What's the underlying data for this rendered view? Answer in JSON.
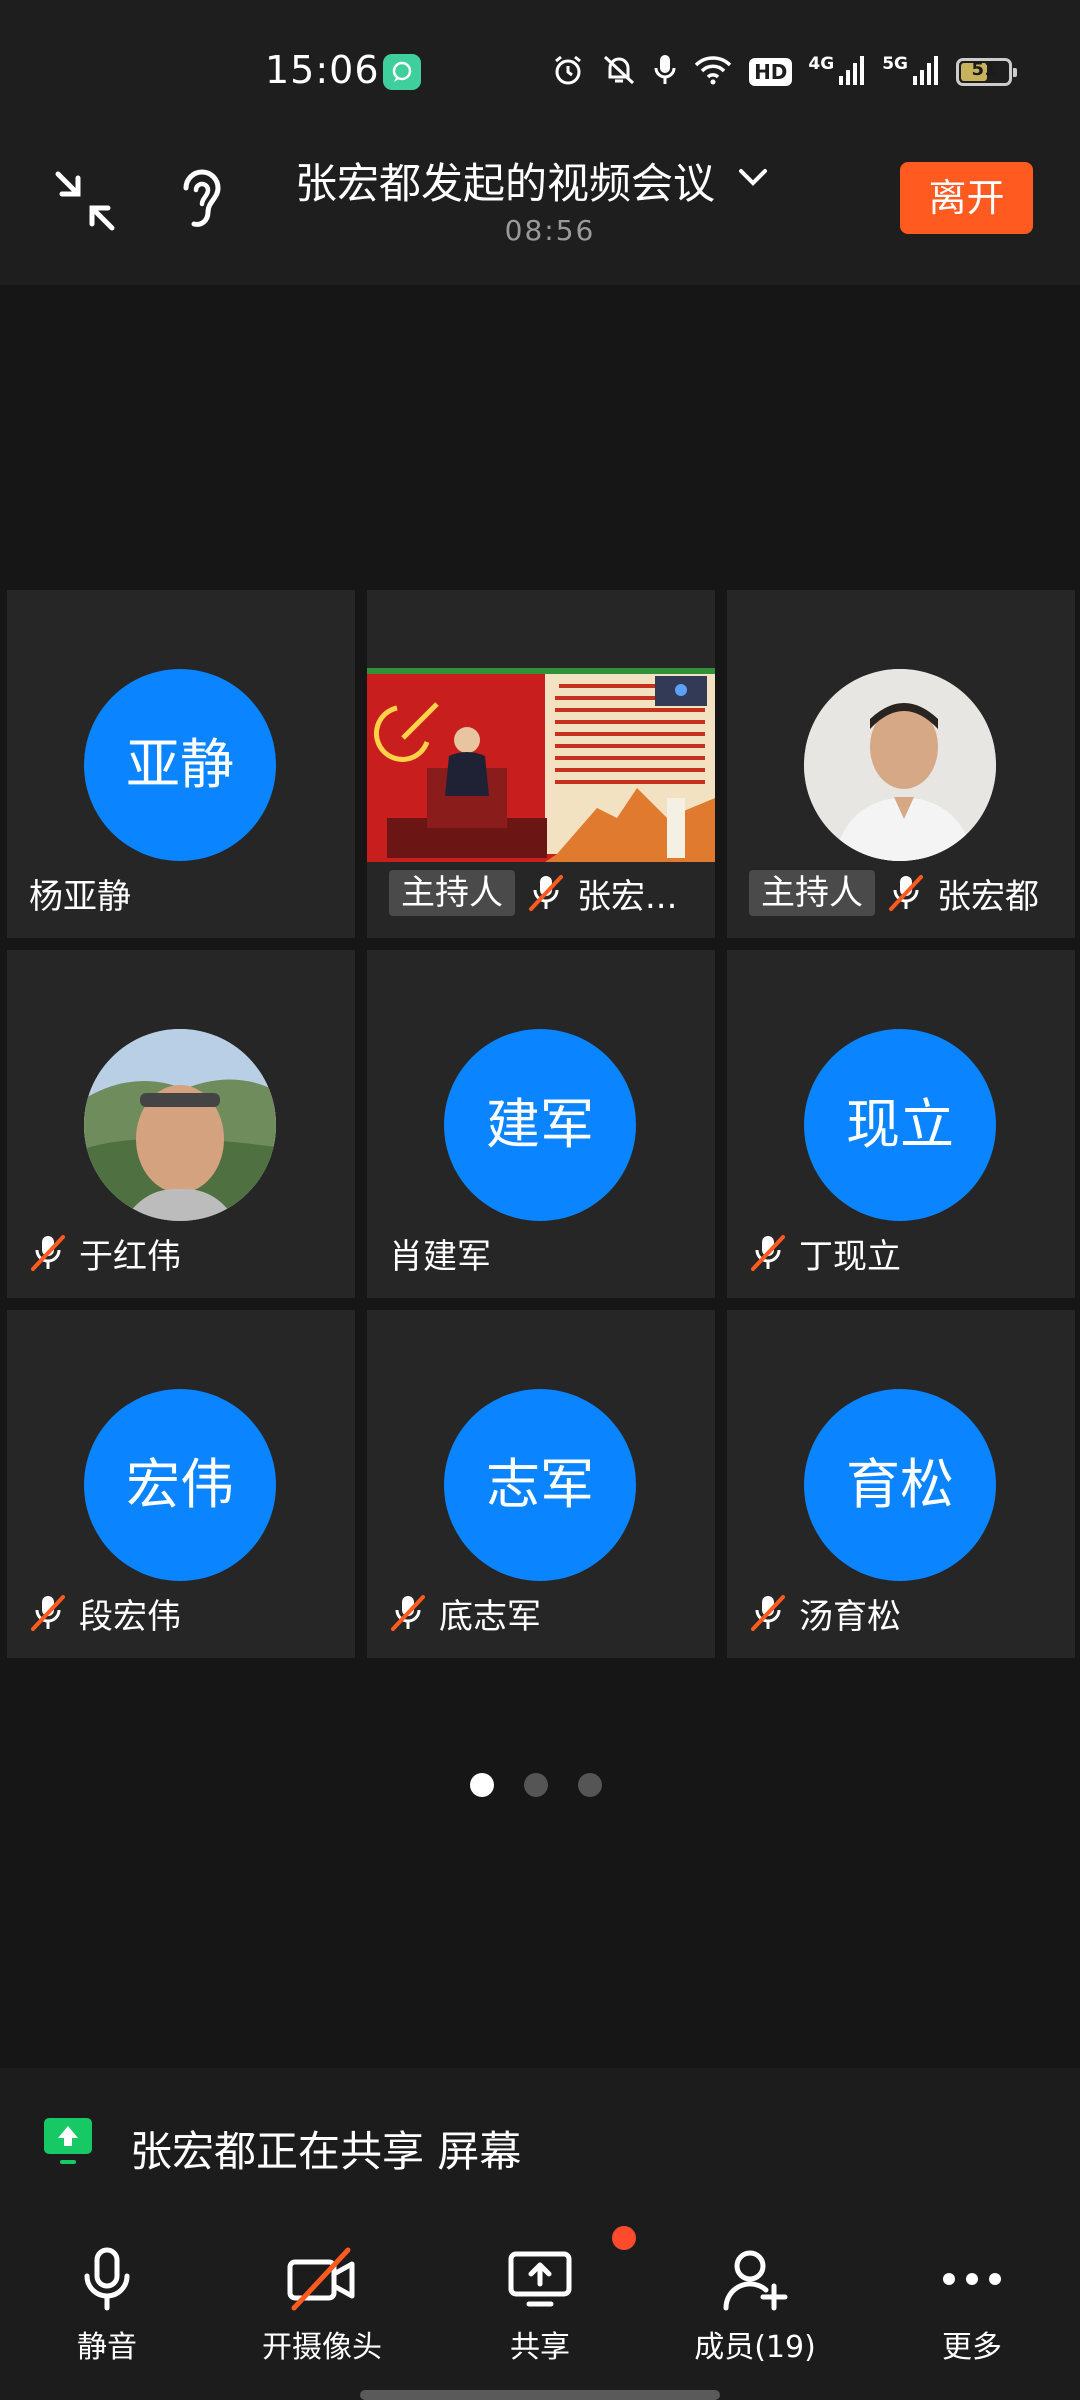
{
  "status_bar": {
    "time": "15:06",
    "hd_label": "HD",
    "net1_label": "4G",
    "net2_label": "5G",
    "battery_level": "51",
    "icons": [
      "chat-bubble-icon",
      "alarm-icon",
      "mute-notifications-icon",
      "microphone-icon",
      "wifi-icon",
      "signal-icon",
      "battery-icon"
    ]
  },
  "header": {
    "title": "张宏都发起的视频会议",
    "timer": "08:56",
    "leave_label": "离开"
  },
  "participants": [
    {
      "avatar_text": "亚静",
      "name": "杨亚静",
      "host_label": "",
      "muted": false,
      "type": "initials"
    },
    {
      "avatar_text": "",
      "name": "张宏...",
      "host_label": "主持人",
      "muted": true,
      "type": "screen-share"
    },
    {
      "avatar_text": "",
      "name": "张宏都",
      "host_label": "主持人",
      "muted": true,
      "type": "photo"
    },
    {
      "avatar_text": "",
      "name": "于红伟",
      "host_label": "",
      "muted": true,
      "type": "photo"
    },
    {
      "avatar_text": "建军",
      "name": "肖建军",
      "host_label": "",
      "muted": false,
      "type": "initials"
    },
    {
      "avatar_text": "现立",
      "name": "丁现立",
      "host_label": "",
      "muted": true,
      "type": "initials"
    },
    {
      "avatar_text": "宏伟",
      "name": "段宏伟",
      "host_label": "",
      "muted": true,
      "type": "initials"
    },
    {
      "avatar_text": "志军",
      "name": "底志军",
      "host_label": "",
      "muted": true,
      "type": "initials"
    },
    {
      "avatar_text": "育松",
      "name": "汤育松",
      "host_label": "",
      "muted": true,
      "type": "initials"
    }
  ],
  "pagination": {
    "total": 3,
    "current": 1
  },
  "share_banner": {
    "text": "张宏都正在共享 屏幕"
  },
  "toolbar": {
    "mute_label": "静音",
    "camera_label": "开摄像头",
    "share_label": "共享",
    "members_label": "成员(19)",
    "more_label": "更多"
  },
  "colors": {
    "background": "#161616",
    "tile": "#262626",
    "avatar": "#0a84ff",
    "leave": "#ff5a1f",
    "mic_off_slash": "#ff5a1f",
    "share_banner_icon": "#17c964"
  }
}
